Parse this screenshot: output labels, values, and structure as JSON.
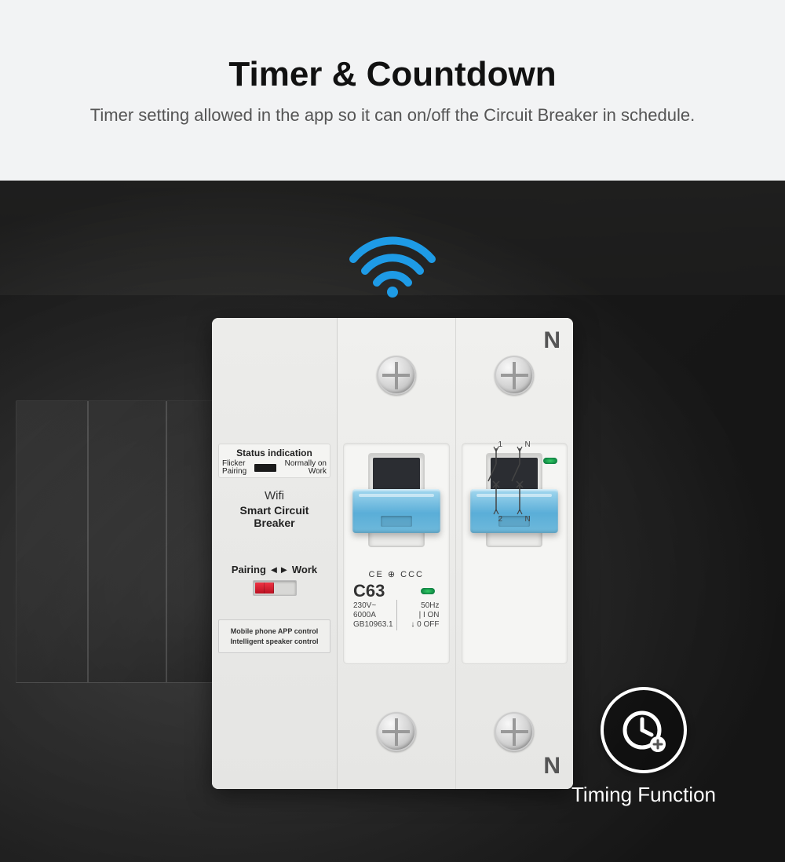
{
  "header": {
    "title": "Timer & Countdown",
    "subtitle": "Timer setting allowed in the app so it can on/off the Circuit Breaker in schedule."
  },
  "device": {
    "n_label": "N",
    "status": {
      "title": "Status indication",
      "left_top": "Flicker",
      "left_bottom": "Pairing",
      "right_top": "Normally on",
      "right_bottom": "Work"
    },
    "wifi_label": "Wifi",
    "product_name": "Smart Circuit Breaker",
    "pairing_label": "Pairing ◄► Work",
    "fine_print_1": "Mobile phone APP control",
    "fine_print_2": "Intelligent speaker control",
    "ce_marks": "CE ⊕ CCC",
    "model": "C63",
    "specs": {
      "voltage": "230V~",
      "freq": "50Hz",
      "breaking": "6000A",
      "on": "| I ON",
      "standard": "GB10963.1",
      "off": "↓ 0 OFF"
    },
    "diagram": {
      "t1": "1",
      "t1n": "N",
      "t2": "2",
      "t2n": "N"
    }
  },
  "badge": {
    "label": "Timing Function"
  },
  "colors": {
    "accent_blue": "#2196e3",
    "switch_blue": "#66b7dd"
  }
}
